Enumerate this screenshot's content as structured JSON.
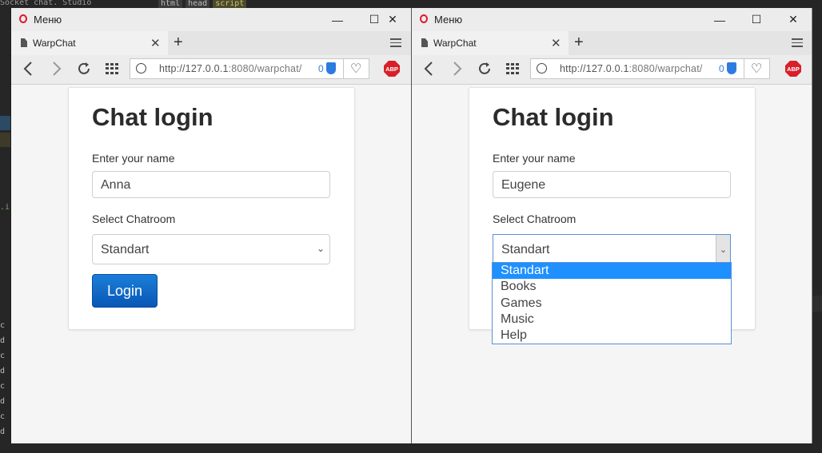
{
  "background_editor": {
    "top_snippet": "Socket chat. Studio",
    "tags": [
      "html",
      "head",
      "script"
    ],
    "indent_marker": ".in",
    "side_letters": [
      "c",
      "d",
      "c",
      "d",
      "c",
      "d",
      "c",
      "d"
    ]
  },
  "windows": [
    {
      "menu_label": "Меню",
      "tab_title": "WarpChat",
      "url_prefix": "http://127.0.0.1",
      "url_suffix": ":8080/warpchat/",
      "shield_count": "0",
      "abp_label": "ABP",
      "card": {
        "heading": "Chat login",
        "name_label": "Enter your name",
        "name_value": "Anna",
        "room_label": "Select Chatroom",
        "room_value": "Standart",
        "login_label": "Login"
      }
    },
    {
      "menu_label": "Меню",
      "tab_title": "WarpChat",
      "url_prefix": "http://127.0.0.1",
      "url_suffix": ":8080/warpchat/",
      "shield_count": "0",
      "abp_label": "ABP",
      "card": {
        "heading": "Chat login",
        "name_label": "Enter your name",
        "name_value": "Eugene",
        "room_label": "Select Chatroom",
        "room_value": "Standart"
      },
      "dropdown_options": [
        "Standart",
        "Books",
        "Games",
        "Music",
        "Help"
      ],
      "dropdown_selected": "Standart"
    }
  ],
  "icons": {
    "back": "chevron-left-icon",
    "forward": "chevron-right-icon",
    "reload": "reload-icon",
    "speed_dial": "grid-icon",
    "globe": "globe-icon",
    "shield": "shield-icon",
    "heart": "heart-icon",
    "adblock": "abp-icon",
    "tab_menu": "tab-menu-icon"
  },
  "colors": {
    "login_button": "#0a57b5",
    "selected_option": "#1e90ff",
    "opera_red": "#e0182b",
    "abp_red": "#d8202a"
  }
}
